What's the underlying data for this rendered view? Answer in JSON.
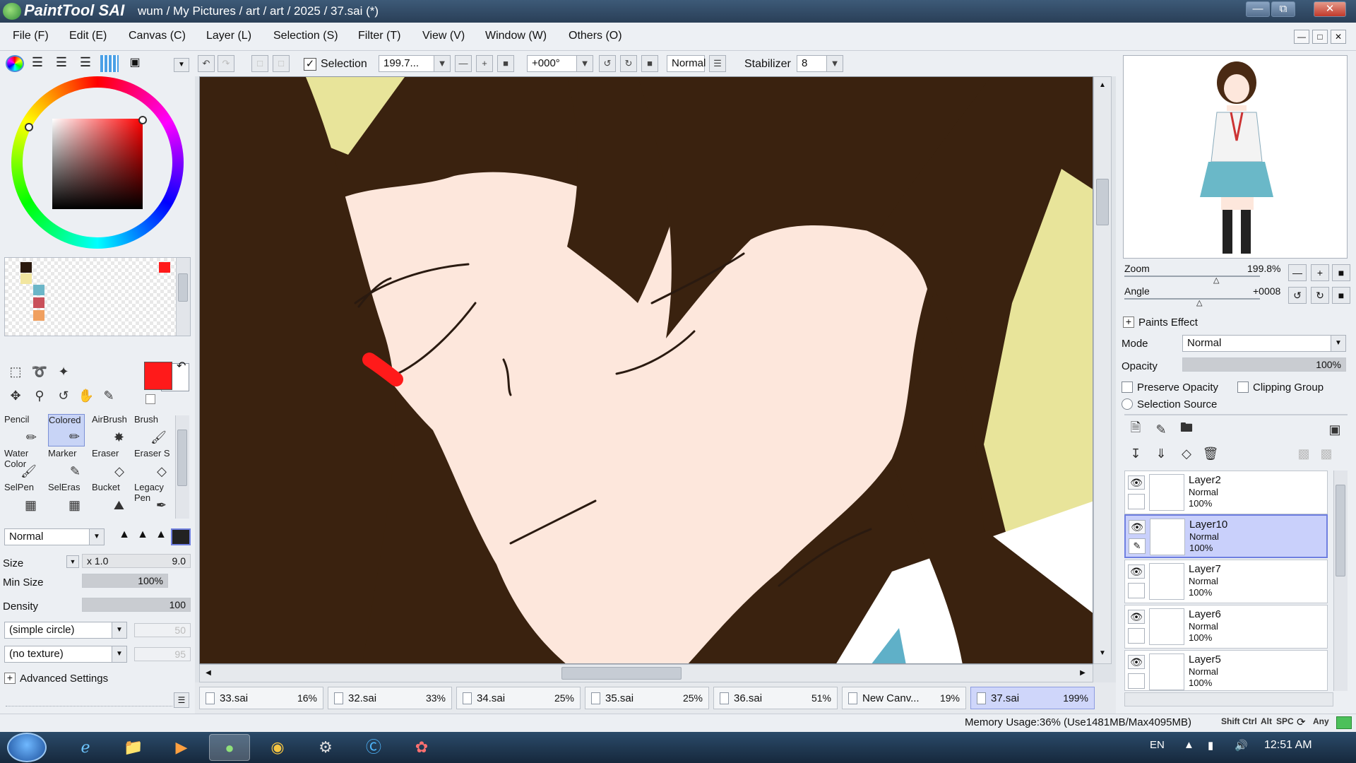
{
  "window": {
    "brand": "PaintTool SAI",
    "path": "wum / My Pictures / art / art / 2025 / 37.sai (*)",
    "controls": [
      "minimize-icon",
      "restore-icon",
      "close-icon"
    ]
  },
  "menu": [
    "File (F)",
    "Edit (E)",
    "Canvas (C)",
    "Layer (L)",
    "Selection (S)",
    "Filter (T)",
    "View (V)",
    "Window (W)",
    "Others (O)"
  ],
  "toolbar": {
    "selection_label": "Selection",
    "selection_checked": true,
    "zoom": "199.7...",
    "angle": "+000°",
    "blend": "Normal",
    "stabilizer_label": "Stabilizer",
    "stabilizer_value": "8"
  },
  "color": {
    "primary": "#ff1a1a",
    "secondary": "#ffffff",
    "swatches": [
      "#2b1a0e",
      "#f2e6a0",
      "#6cb6c8",
      "#c9505a",
      "#f0a060",
      "#ff1a1a"
    ]
  },
  "tools": {
    "brushes": [
      {
        "label": "Pencil",
        "icon": "pencil-icon"
      },
      {
        "label": "Colored",
        "icon": "pencil-icon",
        "active": true
      },
      {
        "label": "AirBrush",
        "icon": "airbrush-icon"
      },
      {
        "label": "Brush",
        "icon": "brush-icon"
      },
      {
        "label": "Water Color",
        "icon": "watercolor-icon"
      },
      {
        "label": "Marker",
        "icon": "marker-icon"
      },
      {
        "label": "Eraser",
        "icon": "eraser-icon"
      },
      {
        "label": "Eraser S",
        "icon": "eraser-icon"
      },
      {
        "label": "SelPen",
        "icon": "selpen-icon"
      },
      {
        "label": "SelEras",
        "icon": "seleraser-icon"
      },
      {
        "label": "Bucket",
        "icon": "bucket-icon"
      },
      {
        "label": "Legacy Pen",
        "icon": "pen-icon"
      }
    ]
  },
  "brush_props": {
    "mode": "Normal",
    "size_label": "Size",
    "size_mult": "x 1.0",
    "size_value": "9.0",
    "min_size_label": "Min Size",
    "min_size_value": "100%",
    "density_label": "Density",
    "density_value": "100",
    "shape": "(simple circle)",
    "shape_value": "50",
    "texture": "(no texture)",
    "texture_value": "95",
    "advanced_label": "Advanced Settings"
  },
  "navigator": {
    "zoom_label": "Zoom",
    "zoom_value": "199.8%",
    "angle_label": "Angle",
    "angle_value": "+0008"
  },
  "layer_props": {
    "paints_effect_label": "Paints Effect",
    "mode_label": "Mode",
    "mode_value": "Normal",
    "opacity_label": "Opacity",
    "opacity_value": "100%",
    "preserve_opacity": "Preserve Opacity",
    "clipping_group": "Clipping Group",
    "selection_source": "Selection Source"
  },
  "layers": [
    {
      "name": "Layer2",
      "mode": "Normal",
      "opacity": "100%",
      "active": false
    },
    {
      "name": "Layer10",
      "mode": "Normal",
      "opacity": "100%",
      "active": true
    },
    {
      "name": "Layer7",
      "mode": "Normal",
      "opacity": "100%",
      "active": false
    },
    {
      "name": "Layer6",
      "mode": "Normal",
      "opacity": "100%",
      "active": false
    },
    {
      "name": "Layer5",
      "mode": "Normal",
      "opacity": "100%",
      "active": false
    }
  ],
  "tabs": [
    {
      "name": "33.sai",
      "pct": "16%"
    },
    {
      "name": "32.sai",
      "pct": "33%"
    },
    {
      "name": "34.sai",
      "pct": "25%"
    },
    {
      "name": "35.sai",
      "pct": "25%"
    },
    {
      "name": "36.sai",
      "pct": "51%"
    },
    {
      "name": "New Canv...",
      "pct": "19%"
    },
    {
      "name": "37.sai",
      "pct": "199%",
      "active": true
    }
  ],
  "status": {
    "memory": "Memory Usage:36% (Use1481MB/Max4095MB)",
    "keys": [
      "Shift",
      "Ctrl",
      "Alt",
      "SPC",
      "Any"
    ]
  },
  "taskbar": {
    "lang": "EN",
    "time": "12:51 AM",
    "apps": [
      "ie-icon",
      "folder-icon",
      "media-player-icon",
      "painttool-sai-icon",
      "chrome-icon",
      "steam-icon",
      "skype-icon",
      "app-icon"
    ]
  }
}
